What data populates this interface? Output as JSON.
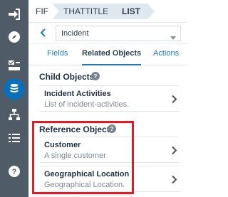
{
  "rail": {
    "items": [
      {
        "icon": "sign-in-icon"
      },
      {
        "icon": "compass-icon"
      },
      {
        "icon": "checklist-icon"
      },
      {
        "icon": "database-icon",
        "active": true
      },
      {
        "icon": "hierarchy-icon"
      },
      {
        "icon": "list-icon"
      },
      {
        "icon": "help-icon"
      }
    ]
  },
  "breadcrumb": {
    "items": [
      "FIF",
      "THATTITLE",
      "LIST"
    ]
  },
  "selector": {
    "value": "Incident"
  },
  "tabs": [
    {
      "label": "Fields"
    },
    {
      "label": "Related Objects",
      "active": true
    },
    {
      "label": "Actions"
    }
  ],
  "child_objects": {
    "title": "Child Objects",
    "items": [
      {
        "title": "Incident Activities",
        "subtitle": "List of incident-activities."
      }
    ]
  },
  "reference_objects": {
    "title": "Reference Objects",
    "items": [
      {
        "title": "Customer",
        "subtitle": "A single customer"
      },
      {
        "title": "Geographical Location",
        "subtitle": "Geographical Location."
      }
    ]
  },
  "colors": {
    "rail": "#4f5b66",
    "accent": "#1f78c1",
    "active_icon": "#0b6fb8",
    "highlight": "#e01b24"
  }
}
